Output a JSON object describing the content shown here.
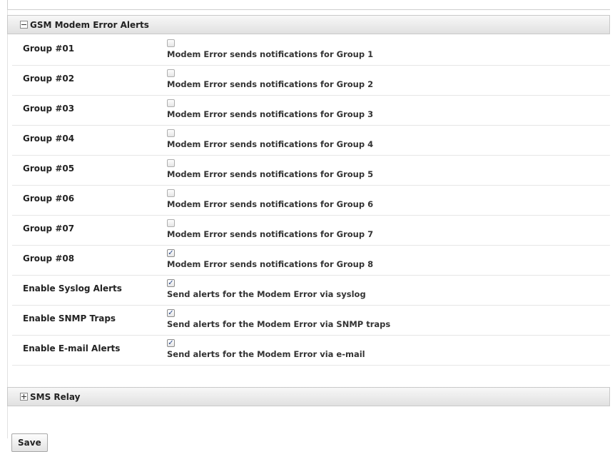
{
  "gsm_section": {
    "title": "GSM Modem Error Alerts",
    "rows": [
      {
        "label": "Group #01",
        "checked": false,
        "desc": "Modem Error sends notifications for Group 1"
      },
      {
        "label": "Group #02",
        "checked": false,
        "desc": "Modem Error sends notifications for Group 2"
      },
      {
        "label": "Group #03",
        "checked": false,
        "desc": "Modem Error sends notifications for Group 3"
      },
      {
        "label": "Group #04",
        "checked": false,
        "desc": "Modem Error sends notifications for Group 4"
      },
      {
        "label": "Group #05",
        "checked": false,
        "desc": "Modem Error sends notifications for Group 5"
      },
      {
        "label": "Group #06",
        "checked": false,
        "desc": "Modem Error sends notifications for Group 6"
      },
      {
        "label": "Group #07",
        "checked": false,
        "desc": "Modem Error sends notifications for Group 7"
      },
      {
        "label": "Group #08",
        "checked": true,
        "desc": "Modem Error sends notifications for Group 8"
      },
      {
        "label": "Enable Syslog Alerts",
        "checked": true,
        "desc": "Send alerts for the Modem Error via syslog"
      },
      {
        "label": "Enable SNMP Traps",
        "checked": true,
        "desc": "Send alerts for the Modem Error via SNMP traps"
      },
      {
        "label": "Enable E-mail Alerts",
        "checked": true,
        "desc": "Send alerts for the Modem Error via e-mail"
      }
    ]
  },
  "sms_section": {
    "title": "SMS Relay"
  },
  "save_label": "Save",
  "icons": {
    "collapse": "collapse-minus-icon",
    "expand": "expand-plus-icon",
    "check": "✓"
  }
}
